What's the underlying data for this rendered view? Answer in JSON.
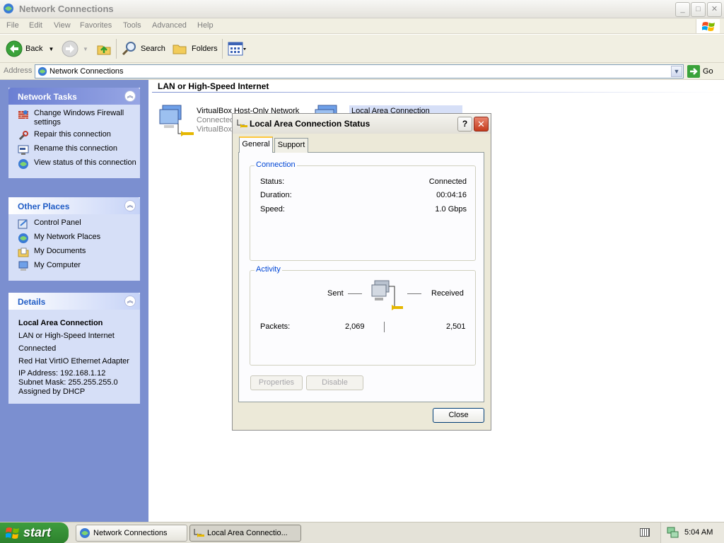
{
  "window": {
    "title": "Network Connections",
    "buttons": {
      "minimize": "_",
      "maximize": "□",
      "close": "✕"
    }
  },
  "menu": [
    "File",
    "Edit",
    "View",
    "Favorites",
    "Tools",
    "Advanced",
    "Help"
  ],
  "toolbar": {
    "back": "Back",
    "search": "Search",
    "folders": "Folders"
  },
  "address": {
    "label": "Address",
    "value": "Network Connections",
    "go": "Go"
  },
  "taskpane": {
    "network_tasks": {
      "title": "Network Tasks",
      "items": [
        {
          "label": "Change Windows Firewall settings",
          "icon": "firewall-icon"
        },
        {
          "label": "Repair this connection",
          "icon": "repair-icon"
        },
        {
          "label": "Rename this connection",
          "icon": "rename-icon"
        },
        {
          "label": "View status of this connection",
          "icon": "status-icon"
        }
      ]
    },
    "other_places": {
      "title": "Other Places",
      "items": [
        {
          "label": "Control Panel",
          "icon": "control-panel-icon"
        },
        {
          "label": "My Network Places",
          "icon": "network-places-icon"
        },
        {
          "label": "My Documents",
          "icon": "documents-icon"
        },
        {
          "label": "My Computer",
          "icon": "computer-icon"
        }
      ]
    },
    "details": {
      "title": "Details",
      "name": "Local Area Connection",
      "type": "LAN or High-Speed Internet",
      "state": "Connected",
      "adapter": "Red Hat VirtIO Ethernet Adapter",
      "ip": "IP Address: 192.168.1.12",
      "mask": "Subnet Mask: 255.255.255.0",
      "assigned": "Assigned by DHCP"
    }
  },
  "content": {
    "heading": "LAN or High-Speed Internet",
    "connections": [
      {
        "name": "VirtualBox Host-Only Network",
        "status": "Connected",
        "device": "VirtualBox"
      },
      {
        "name": "Local Area Connection"
      }
    ]
  },
  "dialog": {
    "title": "Local Area Connection Status",
    "help": "?",
    "close_x": "✕",
    "tabs": [
      "General",
      "Support"
    ],
    "connection": {
      "legend": "Connection",
      "status_label": "Status:",
      "status_value": "Connected",
      "duration_label": "Duration:",
      "duration_value": "00:04:16",
      "speed_label": "Speed:",
      "speed_value": "1.0 Gbps"
    },
    "activity": {
      "legend": "Activity",
      "sent_label": "Sent",
      "received_label": "Received",
      "packets_label": "Packets:",
      "packets_sent": "2,069",
      "packets_received": "2,501"
    },
    "properties": "Properties",
    "disable": "Disable",
    "close": "Close"
  },
  "taskbar": {
    "start": "start",
    "tasks": [
      "Network Connections",
      "Local Area Connectio..."
    ],
    "clock": "5:04 AM"
  }
}
